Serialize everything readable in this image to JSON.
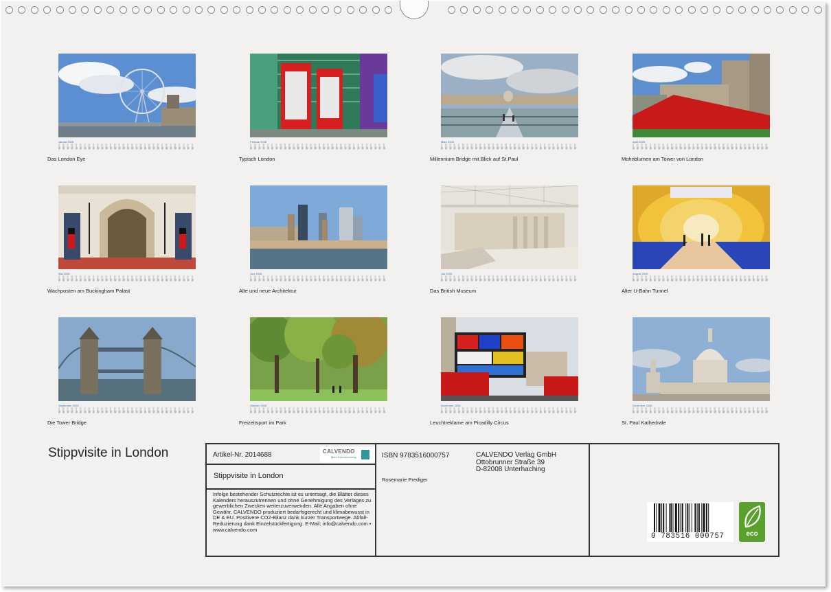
{
  "calendar": {
    "title": "Stippvisite in London",
    "months": [
      {
        "month": "Januar",
        "year": "2026",
        "caption": "Das London Eye",
        "icon": "london-eye-photo"
      },
      {
        "month": "Februar",
        "year": "2026",
        "caption": "Typisch London",
        "icon": "phone-box-photo"
      },
      {
        "month": "März",
        "year": "2026",
        "caption": "Millennium Bridge mit Blick auf St.Paul",
        "icon": "millennium-bridge-photo"
      },
      {
        "month": "April",
        "year": "2026",
        "caption": "Mohnblumen am Tower von London",
        "icon": "tower-poppies-photo"
      },
      {
        "month": "Mai",
        "year": "2026",
        "caption": "Wachposten am Buckingham Palast",
        "icon": "buckingham-guards-photo"
      },
      {
        "month": "Juni",
        "year": "2026",
        "caption": "Alte und neue Architektur",
        "icon": "skyline-photo"
      },
      {
        "month": "Juli",
        "year": "2026",
        "caption": "Das British Museum",
        "icon": "british-museum-photo"
      },
      {
        "month": "August",
        "year": "2026",
        "caption": "Alter U-Bahn Tunnel",
        "icon": "tube-tunnel-photo"
      },
      {
        "month": "September",
        "year": "2026",
        "caption": "Die Tower Bridge",
        "icon": "tower-bridge-photo"
      },
      {
        "month": "Oktober",
        "year": "2026",
        "caption": "Freizeitsport im Park",
        "icon": "park-photo"
      },
      {
        "month": "November",
        "year": "2026",
        "caption": "Leuchtreklame am Picadilly Circus",
        "icon": "piccadilly-photo"
      },
      {
        "month": "Dezember",
        "year": "2026",
        "caption": "St. Paul Kathedrale",
        "icon": "st-pauls-photo"
      }
    ]
  },
  "back_info": {
    "artikel": "Artikel-Nr. 2014688",
    "publisher_logo": "CALVENDO",
    "publisher_tagline": "Mein Kalenderverlag",
    "subtitle": "Stippvisite in London",
    "legal_text": "Infolge bestehender Schutzrechte ist es untersagt, die Blätter dieses Kalenders herauszutrennen und ohne Genehmigung des Verlages zu gewerblichen Zwecken weiterzuverwenden. Alle Angaben ohne Gewähr. CALVENDO produziert bedarfsgerecht und klimabewusst in DE & EU. Positivere CO2-Bilanz dank kurzer Transportwege. Abfall-Reduzierung dank Einzelstückfertigung. E-Mail: info@calvendo.com • www.calvendo.com",
    "isbn": "ISBN 9783516000757",
    "verlag_name": "CALVENDO Verlag GmbH",
    "verlag_street": "Ottobrunner Straße 39",
    "verlag_city": "D-82008 Unterhaching",
    "author": "Rosemarie Prediger",
    "barcode_digits": "9 783516 000757",
    "eco_label": "eco",
    "colors": {
      "eco_green": "#5aa02c",
      "calvendo_teal": "#2c9a9a",
      "month_blue": "#3a6fb5"
    }
  }
}
